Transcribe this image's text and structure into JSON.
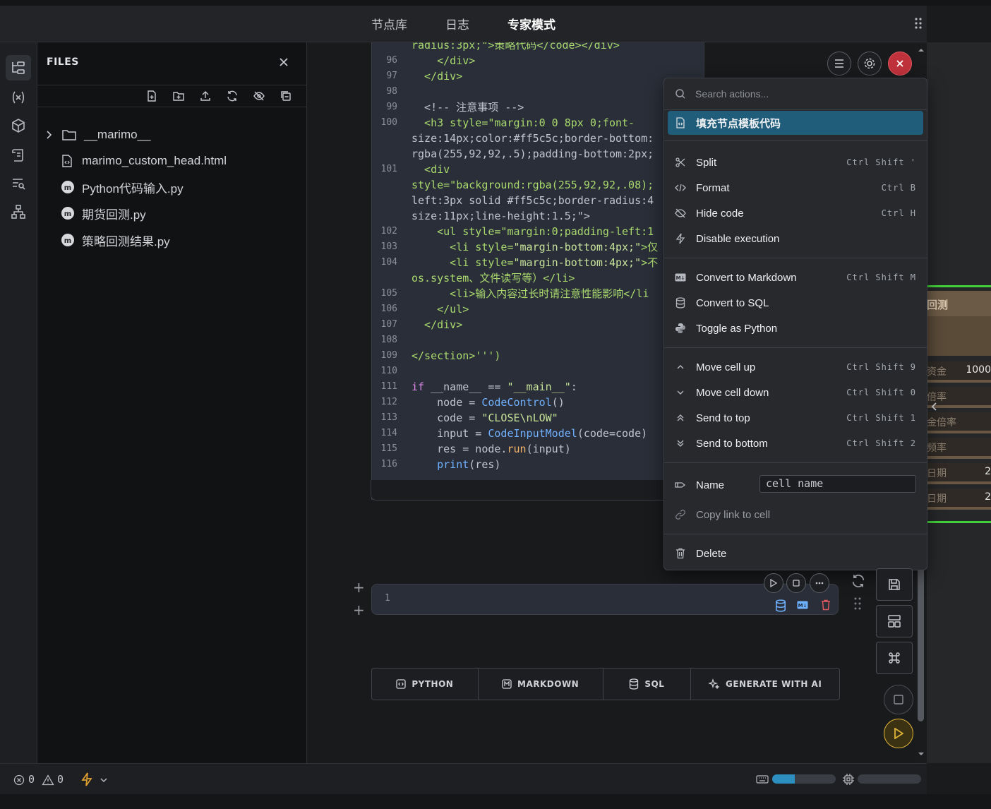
{
  "header": {
    "tabs": [
      {
        "label": "节点库"
      },
      {
        "label": "日志"
      },
      {
        "label": "专家模式"
      }
    ]
  },
  "files": {
    "title": "FILES",
    "tree": [
      {
        "name": "__marimo__",
        "type": "folder"
      },
      {
        "name": "marimo_custom_head.html",
        "type": "html"
      },
      {
        "name": "Python代码输入.py",
        "type": "marimo"
      },
      {
        "name": "期货回测.py",
        "type": "marimo"
      },
      {
        "name": "策略回测结果.py",
        "type": "marimo"
      }
    ]
  },
  "editor": {
    "lines": [
      {
        "n": "",
        "text": "radius:3px;\">策略代码</code></div>"
      },
      {
        "n": "96",
        "text": "    </div>"
      },
      {
        "n": "97",
        "text": "  </div>"
      },
      {
        "n": "98",
        "text": ""
      },
      {
        "n": "99",
        "text": "  <!-- 注意事项 -->"
      },
      {
        "n": "100",
        "text": "  <h3 style=\"margin:0 0 8px 0;font-"
      },
      {
        "n": "",
        "text": "size:14px;color:#ff5c5c;border-bottom:"
      },
      {
        "n": "",
        "text": "rgba(255,92,92,.5);padding-bottom:2px;"
      },
      {
        "n": "101",
        "text": "  <div"
      },
      {
        "n": "",
        "text": "style=\"background:rgba(255,92,92,.08);"
      },
      {
        "n": "",
        "text": "left:3px solid #ff5c5c;border-radius:4"
      },
      {
        "n": "",
        "text": "size:11px;line-height:1.5;\">"
      },
      {
        "n": "102",
        "text": "    <ul style=\"margin:0;padding-left:1"
      },
      {
        "n": "103",
        "text": "      <li style=\"margin-bottom:4px;\">仅"
      },
      {
        "n": "104",
        "text": "      <li style=\"margin-bottom:4px;\">不"
      },
      {
        "n": "",
        "text": "os.system、文件读写等）</li>"
      },
      {
        "n": "105",
        "text": "      <li>输入内容过长时请注意性能影响</li"
      },
      {
        "n": "106",
        "text": "    </ul>"
      },
      {
        "n": "107",
        "text": "  </div>"
      },
      {
        "n": "108",
        "text": ""
      },
      {
        "n": "109",
        "text": "</section>''')"
      },
      {
        "n": "110",
        "text": ""
      },
      {
        "n": "111",
        "text": "if __name__ == \"__main__\":"
      },
      {
        "n": "112",
        "text": "    node = CodeControl()"
      },
      {
        "n": "113",
        "text": "    code = \"CLOSE\\nLOW\""
      },
      {
        "n": "114",
        "text": "    input = CodeInputModel(code=code)"
      },
      {
        "n": "115",
        "text": "    res = node.run(input)"
      },
      {
        "n": "116",
        "text": "    print(res)"
      }
    ]
  },
  "menu": {
    "search_placeholder": "Search actions...",
    "items": [
      {
        "label": "填充节点模板代码",
        "shortcut": "",
        "icon": "file-code-icon"
      },
      {
        "label": "Split",
        "shortcut": "Ctrl Shift '",
        "icon": "scissors-icon"
      },
      {
        "label": "Format",
        "shortcut": "Ctrl B",
        "icon": "code-brackets-icon"
      },
      {
        "label": "Hide code",
        "shortcut": "Ctrl H",
        "icon": "eye-off-icon"
      },
      {
        "label": "Disable execution",
        "shortcut": "",
        "icon": "zap-off-icon"
      },
      {
        "label": "Convert to Markdown",
        "shortcut": "Ctrl Shift M",
        "icon": "markdown-icon"
      },
      {
        "label": "Convert to SQL",
        "shortcut": "",
        "icon": "database-icon"
      },
      {
        "label": "Toggle as Python",
        "shortcut": "",
        "icon": "python-icon"
      },
      {
        "label": "Move cell up",
        "shortcut": "Ctrl Shift 9",
        "icon": "chevron-up-icon"
      },
      {
        "label": "Move cell down",
        "shortcut": "Ctrl Shift 0",
        "icon": "chevron-down-icon"
      },
      {
        "label": "Send to top",
        "shortcut": "Ctrl Shift 1",
        "icon": "chevrons-up-icon"
      },
      {
        "label": "Send to bottom",
        "shortcut": "Ctrl Shift 2",
        "icon": "chevrons-down-icon"
      },
      {
        "label": "Name",
        "shortcut": "",
        "icon": "tag-icon"
      },
      {
        "label": "Copy link to cell",
        "shortcut": "",
        "icon": "link-icon"
      },
      {
        "label": "Delete",
        "shortcut": "",
        "icon": "trash-icon"
      }
    ],
    "name_value": "cell name"
  },
  "cell2": {
    "line_number": "1"
  },
  "add_bar": {
    "python": "PYTHON",
    "markdown": "MARKDOWN",
    "sql": "SQL",
    "ai": "GENERATE WITH AI"
  },
  "right_panel": {
    "title": "回测",
    "rows": [
      {
        "label": "资金",
        "value": "1000"
      },
      {
        "label": "倍率",
        "value": ""
      },
      {
        "label": "金倍率",
        "value": ""
      },
      {
        "label": "频率",
        "value": ""
      },
      {
        "label": "日期",
        "value": "2"
      },
      {
        "label": "日期",
        "value": "2"
      }
    ]
  },
  "status": {
    "errors": "0",
    "warnings": "0"
  },
  "colors": {
    "accent_blue": "#1f5d7a",
    "danger": "#c0323b",
    "run_yellow": "#e0b43a",
    "panel_green": "#43d13b"
  }
}
